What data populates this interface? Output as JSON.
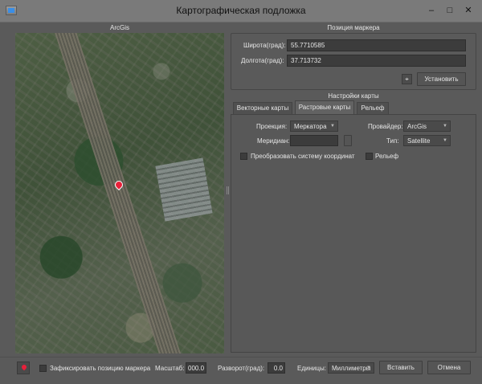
{
  "window": {
    "title": "Картографическая подложка",
    "minimize": "–",
    "maximize": "□",
    "close": "✕"
  },
  "map_panel": {
    "title": "ArcGis"
  },
  "marker_position": {
    "title": "Позиция маркера",
    "lat_label": "Широта(град):",
    "lat_value": "55.7710585",
    "lon_label": "Долгота(град):",
    "lon_value": "37.713732",
    "set_button": "Установить"
  },
  "map_settings": {
    "title": "Настройки карты",
    "tabs": [
      {
        "label": "Векторные карты",
        "active": false
      },
      {
        "label": "Растровые карты",
        "active": true
      },
      {
        "label": "Рельеф",
        "active": false
      }
    ],
    "projection_label": "Проекция:",
    "projection_value": "Меркатора",
    "provider_label": "Провайдер:",
    "provider_value": "ArcGis",
    "meridian_label": "Меридиан:",
    "meridian_value": "",
    "type_label": "Тип:",
    "type_value": "Satellite",
    "convert_label": "Преобразовать систему координат",
    "relief_label": "Рельеф"
  },
  "footer": {
    "fix_marker_label": "Зафиксировать позицию маркера",
    "scale_label": "Масштаб:",
    "scale_value": "000.0",
    "rotation_label": "Разворот(град):",
    "rotation_value": "0.0",
    "units_label": "Единицы:",
    "units_value": "Миллиметры",
    "insert_button": "Вставить",
    "cancel_button": "Отмена"
  },
  "icons": {
    "app": "app-window-icon",
    "target": "crosshair-icon",
    "marker": "map-pin-icon"
  },
  "colors": {
    "marker": "#e8203a",
    "background": "#5a5a5a"
  }
}
